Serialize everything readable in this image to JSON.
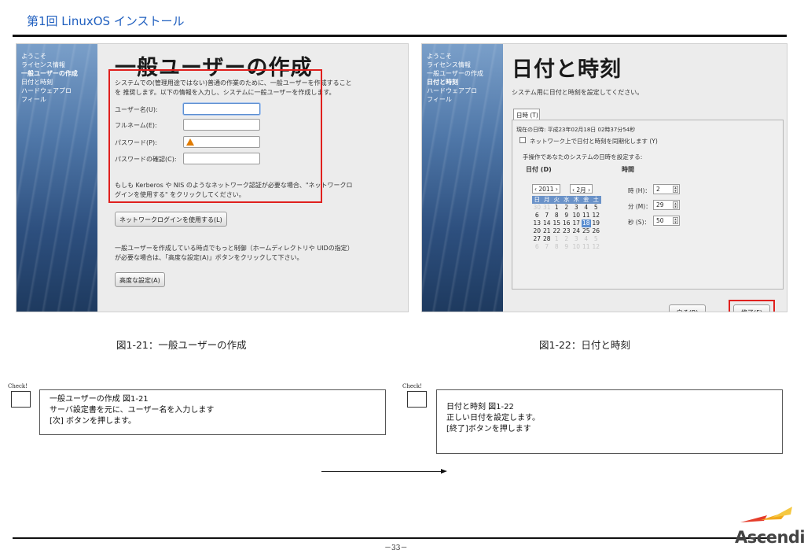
{
  "document": {
    "title": "第1回 LinuxOS インストール",
    "page_number": "－33－",
    "logo_text": "Ascendia"
  },
  "left_screenshot": {
    "sidebar": [
      "ようこそ",
      "ライセンス情報",
      "一般ユーザーの作成",
      "日付と時刻",
      "ハードウェアプロ",
      "フィール"
    ],
    "active_index": 2,
    "title": "一般ユーザーの作成",
    "intro_line1": "システムでの(管理用途ではない)普通の作業のために、一般ユーザーを作成すること",
    "intro_line2": "を 推奨します。以下の情報を入力し、システムに一般ユーザーを作成します。",
    "fields": {
      "username_label": "ユーザー名(U):",
      "fullname_label": "フルネーム(E):",
      "password_label": "パスワード(P):",
      "confirm_label": "パスワードの確認(C):"
    },
    "kerberos_line1": "もしも Kerberos や NIS のようなネットワーク認証が必要な場合、\"ネットワークロ",
    "kerberos_line2": "グインを使用する\" をクリックしてください。",
    "network_login_button": "ネットワークログインを使用する(L)",
    "advanced_line1": "一般ユーザーを作成している時点でもっと制御（ホームディレクトリや UIDの指定）",
    "advanced_line2": "が必要な場合は、「高度な設定(A)」ボタンをクリックして下さい。",
    "advanced_button": "高度な設定(A)"
  },
  "right_screenshot": {
    "sidebar": [
      "ようこそ",
      "ライセンス情報",
      "一般ユーザーの作成",
      "日付と時刻",
      "ハードウェアプロ",
      "フィール"
    ],
    "active_index": 3,
    "title": "日付と時刻",
    "intro": "システム用に日付と時刻を設定してください。",
    "tab_label": "日時 (T)",
    "current_datetime": "現在の日時:  平成23年02月18日  02時37分54秒",
    "sync_label": "ネットワーク上で日付と時刻を同期化します (Y)",
    "manual_label": "手操作であなたのシステムの日時を設定する:",
    "date_header": "日付 (D)",
    "time_header": "時間",
    "calendar": {
      "year": "2011",
      "month": "2月",
      "weekdays": [
        "日",
        "月",
        "火",
        "水",
        "木",
        "金",
        "土"
      ],
      "weeks": [
        [
          "30",
          "31",
          "1",
          "2",
          "3",
          "4",
          "5"
        ],
        [
          "6",
          "7",
          "8",
          "9",
          "10",
          "11",
          "12"
        ],
        [
          "13",
          "14",
          "15",
          "16",
          "17",
          "18",
          "19"
        ],
        [
          "20",
          "21",
          "22",
          "23",
          "24",
          "25",
          "26"
        ],
        [
          "27",
          "28",
          "1",
          "2",
          "3",
          "4",
          "5"
        ],
        [
          "6",
          "7",
          "8",
          "9",
          "10",
          "11",
          "12"
        ]
      ],
      "selected_day": "18"
    },
    "time": {
      "hour_label": "時 (H)：",
      "hour_value": "2",
      "minute_label": "分 (M)：",
      "minute_value": "29",
      "second_label": "秒 (S)：",
      "second_value": "50"
    },
    "back_button": "戻る(B)",
    "finish_button": "終了(F)"
  },
  "captions": {
    "left": "図1-21：一般ユーザーの作成",
    "right": "図1-22：日付と時刻"
  },
  "checks": {
    "label": "Check!",
    "left_lines": [
      "一般ユーザーの作成  図1-21",
      "サーバ設定書を元に、ユーザー名を入力します",
      "[次] ボタンを押します。"
    ],
    "right_lines": [
      "日付と時刻 図1-22",
      "正しい日付を設定します。",
      "[終了]ボタンを押します"
    ]
  },
  "colors": {
    "title_blue": "#1f5fbf",
    "highlight_red": "#e0201e",
    "calendar_selected": "#5b8ed1"
  }
}
